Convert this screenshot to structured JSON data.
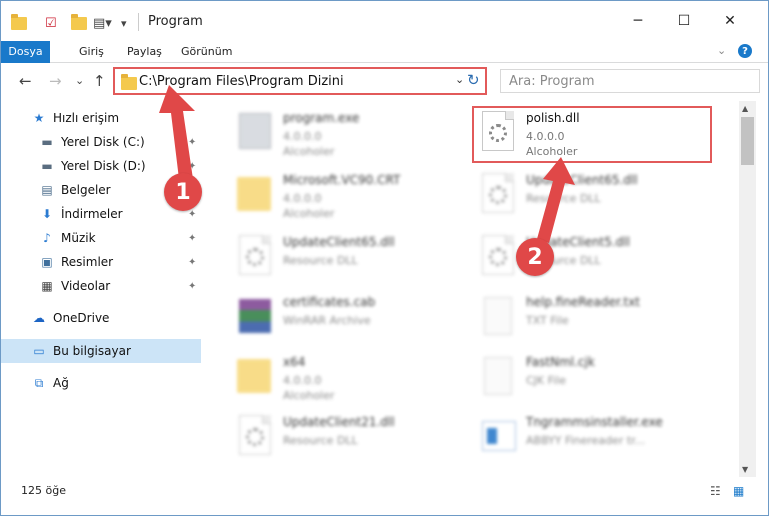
{
  "window": {
    "title": "Program",
    "controls": {
      "minimize": "─",
      "maximize": "☐",
      "close": "✕"
    }
  },
  "ribbon": {
    "tabs": [
      "Dosya",
      "Giriş",
      "Paylaş",
      "Görünüm"
    ],
    "expand_glyph": "⌄",
    "help_glyph": "?"
  },
  "nav": {
    "back": "←",
    "forward": "→",
    "recent": "⌄",
    "up": "↑",
    "address": "C:\\Program Files\\Program Dizini",
    "address_dropdown": "⌄",
    "refresh": "↻",
    "search_placeholder": "Ara: Program"
  },
  "sidebar": {
    "items": [
      {
        "label": "Hızlı erişim",
        "icon": "★"
      },
      {
        "label": "Yerel Disk (C:)",
        "icon": "▬",
        "pinned": "📌"
      },
      {
        "label": "Yerel Disk (D:)",
        "icon": "▬",
        "pinned": "📌"
      },
      {
        "label": "Belgeler",
        "icon": "▤",
        "pinned": "📌"
      },
      {
        "label": "İndirmeler",
        "icon": "⬇",
        "pinned": "📌"
      },
      {
        "label": "Müzik",
        "icon": "♪",
        "pinned": "📌"
      },
      {
        "label": "Resimler",
        "icon": "▣",
        "pinned": "📌"
      },
      {
        "label": "Videolar",
        "icon": "▦",
        "pinned": "📌"
      },
      {
        "label": "OneDrive",
        "icon": "☁"
      },
      {
        "label": "Bu bilgisayar",
        "icon": "▭"
      },
      {
        "label": "Ağ",
        "icon": "⧉"
      }
    ]
  },
  "files": [
    {
      "name": "program.exe",
      "line1": "4.0.0.0",
      "line2": "Alcoholer",
      "kind": "exe"
    },
    {
      "name": "polish.dll",
      "line1": "4.0.0.0",
      "line2": "Alcoholer",
      "kind": "dll"
    },
    {
      "name": "Microsoft.VC90.CRT",
      "line1": "4.0.0.0",
      "line2": "Alcoholer",
      "kind": "folder"
    },
    {
      "name": "UpdateClient65.dll",
      "line1": "Resource DLL",
      "line2": "",
      "kind": "dll"
    },
    {
      "name": "UpdateClient65.dll",
      "line1": "Resource DLL",
      "line2": "",
      "kind": "dll"
    },
    {
      "name": "UpdateClient5.dll",
      "line1": "Resource DLL",
      "line2": "",
      "kind": "dll"
    },
    {
      "name": "certificates.cab",
      "line1": "WinRAR Archive",
      "line2": "",
      "kind": "cab"
    },
    {
      "name": "help.fineReader.txt",
      "line1": "TXT File",
      "line2": "",
      "kind": "txt"
    },
    {
      "name": "x64",
      "line1": "4.0.0.0",
      "line2": "Alcoholer",
      "kind": "folder"
    },
    {
      "name": "FastNml.cjk",
      "line1": "CJK File",
      "line2": "",
      "kind": "txt"
    },
    {
      "name": "UpdateClient21.dll",
      "line1": "Resource DLL",
      "line2": "",
      "kind": "dll"
    },
    {
      "name": "Tngrammsinstaller.exe",
      "line1": "ABBYY Finereader tr...",
      "line2": "",
      "kind": "inst"
    }
  ],
  "status": {
    "count": "125 öğe"
  },
  "annotations": {
    "step1": "1",
    "step2": "2"
  },
  "colors": {
    "accent": "#1979ca",
    "annotation": "#e04848"
  }
}
